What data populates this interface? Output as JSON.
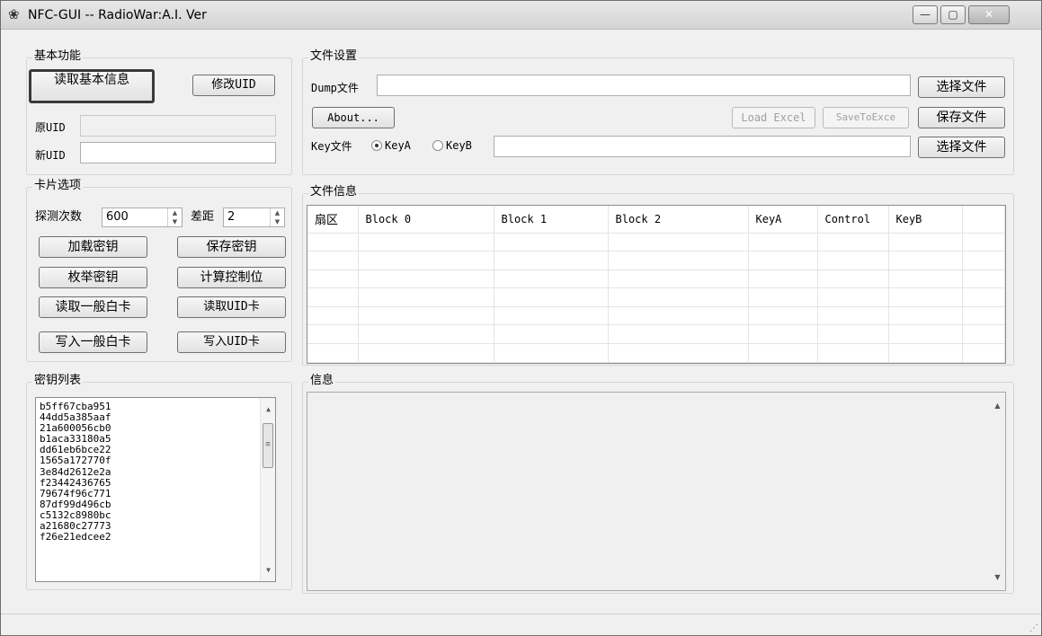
{
  "window": {
    "title": "NFC-GUI  -- RadioWar:A.I. Ver",
    "controls": {
      "minimize": "—",
      "maximize": "▢",
      "close": "✕"
    }
  },
  "basic": {
    "legend": "基本功能",
    "read_info_button": "读取基本信息",
    "modify_uid_button": "修改UID",
    "orig_uid_label": "原UID",
    "orig_uid_value": "",
    "new_uid_label": "新UID",
    "new_uid_value": ""
  },
  "file_settings": {
    "legend": "文件设置",
    "dump_label": "Dump文件",
    "dump_value": "",
    "select_file_button": "选择文件",
    "about_button": "About...",
    "load_excel_button": "Load Excel",
    "save_to_excel_button": "SaveToExce",
    "save_file_button": "保存文件",
    "key_file_label": "Key文件",
    "key_a_label": "KeyA",
    "key_b_label": "KeyB",
    "selected_key": "KeyA",
    "key_file_value": "",
    "select_key_file_button": "选择文件"
  },
  "card_options": {
    "legend": "卡片选项",
    "probe_label": "探测次数",
    "probe_value": "600",
    "diff_label": "差距",
    "diff_value": "2",
    "buttons": {
      "load_keys": "加载密钥",
      "save_keys": "保存密钥",
      "enum_keys": "枚举密钥",
      "calc_bits": "计算控制位",
      "read_normal": "读取一般白卡",
      "read_uid": "读取UID卡",
      "write_normal": "写入一般白卡",
      "write_uid": "写入UID卡"
    }
  },
  "file_info": {
    "legend": "文件信息",
    "columns": [
      "扇区",
      "Block 0",
      "Block 1",
      "Block 2",
      "KeyA",
      "Control",
      "KeyB",
      ""
    ]
  },
  "key_list": {
    "legend": "密钥列表",
    "items": [
      "b5ff67cba951",
      "44dd5a385aaf",
      "21a600056cb0",
      "b1aca33180a5",
      "dd61eb6bce22",
      "1565a172770f",
      "3e84d2612e2a",
      "f23442436765",
      "79674f96c771",
      "87df99d496cb",
      "c5132c8980bc",
      "a21680c27773",
      "f26e21edcee2"
    ],
    "scrollbar": {
      "up": "▲",
      "down": "▼",
      "thumb": "≡"
    }
  },
  "info": {
    "legend": "信息",
    "scrollbar": {
      "up": "▲",
      "down": "▼"
    }
  },
  "statusbar": {
    "grip": "⋰"
  }
}
